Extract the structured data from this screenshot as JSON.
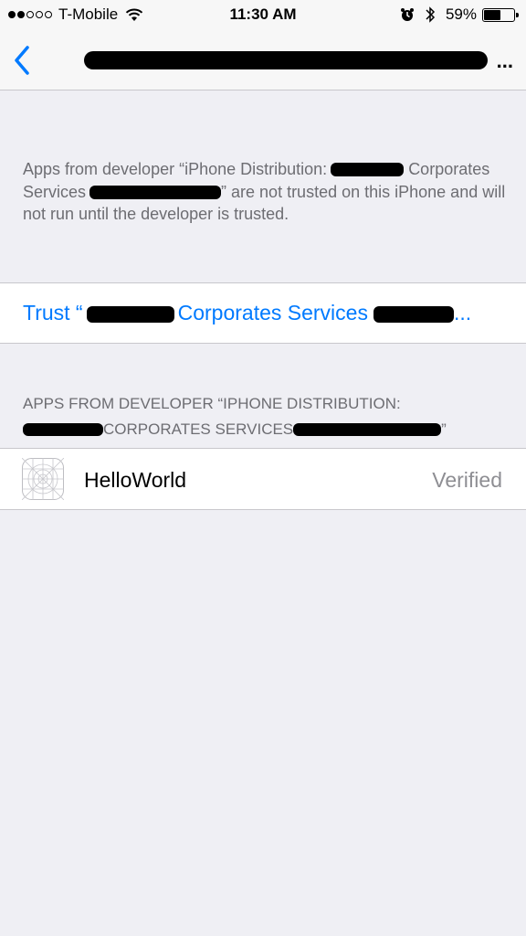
{
  "status_bar": {
    "carrier": "T-Mobile",
    "time": "11:30 AM",
    "battery": "59%",
    "battery_level": 0.59,
    "signal_bars_filled": 2,
    "signal_bars_total": 5
  },
  "nav": {
    "back_icon": "chevron-left-icon",
    "title_ellipsis": "..."
  },
  "description": {
    "part1": "Apps from developer “iPhone Distribution:",
    "part2": "Corporates Services",
    "part3": "” are not trusted on this iPhone and will not run until the developer is trusted."
  },
  "trust": {
    "prefix": "Trust “",
    "middle": "Corporates Services",
    "suffix": "..."
  },
  "section": {
    "line1": "APPS FROM DEVELOPER “IPHONE DISTRIBUTION:",
    "line2": "CORPORATES SERVICES",
    "close": "”"
  },
  "app": {
    "name": "HelloWorld",
    "status": "Verified",
    "icon": "app-placeholder-icon"
  },
  "colors": {
    "accent": "#007aff",
    "background": "#efeff4",
    "secondary_text": "#6d6d72"
  }
}
